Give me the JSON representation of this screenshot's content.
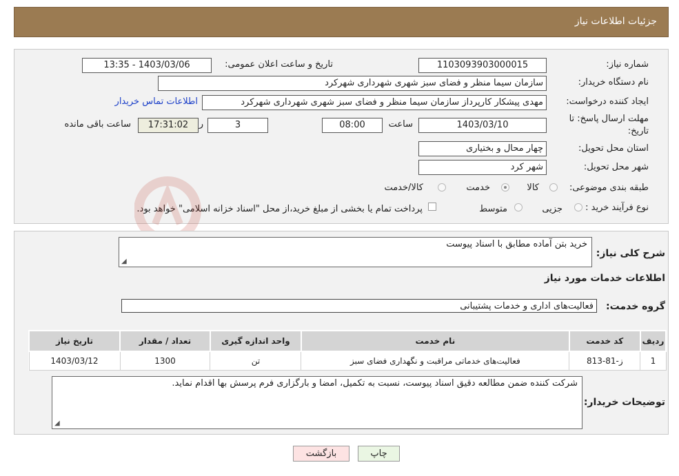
{
  "header": {
    "title": "جزئیات اطلاعات نیاز"
  },
  "form": {
    "need_number_label": "شماره نیاز:",
    "need_number": "1103093903000015",
    "announce_label": "تاریخ و ساعت اعلان عمومی:",
    "announce_value": "1403/03/06 - 13:35",
    "buyer_org_label": "نام دستگاه خریدار:",
    "buyer_org": "سازمان سیما منظر و فضای سبز شهری شهرداری شهرکرد",
    "creator_label": "ایجاد کننده درخواست:",
    "creator": "مهدی پیشکار کارپرداز سازمان سیما منظر و فضای سبز شهری شهرداری شهرکرد",
    "contact_link": "اطلاعات تماس خریدار",
    "deadline_label_line1": "مهلت ارسال پاسخ: تا",
    "deadline_label_line2": "تاریخ:",
    "deadline_date": "1403/03/10",
    "time_label": "ساعت",
    "deadline_time": "08:00",
    "days_value": "3",
    "days_label": "روز و",
    "remaining_time": "17:31:02",
    "remaining_label": "ساعت باقی مانده",
    "province_label": "استان محل تحویل:",
    "province": "چهار محال و بختیاری",
    "city_label": "شهر محل تحویل:",
    "city": "شهر کرد",
    "category_label": "طبقه بندی موضوعی:",
    "category_options": [
      "کالا",
      "خدمت",
      "کالا/خدمت"
    ],
    "category_selected": "خدمت",
    "process_label": "نوع فرآیند خرید :",
    "process_options": [
      "جزیی",
      "متوسط"
    ],
    "payment_note": "پرداخت تمام یا بخشی از مبلغ خرید،از محل \"اسناد خزانه اسلامی\" خواهد بود."
  },
  "details": {
    "summary_label": "شرح کلی نیاز:",
    "summary": "خرید بتن آماده مطابق با اسناد پیوست",
    "services_title": "اطلاعات خدمات مورد نیاز",
    "service_group_label": "گروه خدمت:",
    "service_group": "فعالیت‌های اداری و خدمات پشتیبانی",
    "table": {
      "headers": [
        "ردیف",
        "کد خدمت",
        "نام خدمت",
        "واحد اندازه گیری",
        "تعداد / مقدار",
        "تاریخ نیاز"
      ],
      "rows": [
        [
          "1",
          "ز-81-813",
          "فعالیت‌های خدماتی مراقبت و نگهداری فضای سبز",
          "تن",
          "1300",
          "1403/03/12"
        ]
      ]
    },
    "buyer_notes_label": "توضیحات خریدار:",
    "buyer_notes": "شرکت کننده ضمن مطالعه دقیق اسناد پیوست، نسبت به تکمیل، امضا و بارگزاری فرم پرسش بها اقدام نماید."
  },
  "buttons": {
    "print": "چاپ",
    "back": "بازگشت"
  },
  "watermark": "AriaTender.net"
}
